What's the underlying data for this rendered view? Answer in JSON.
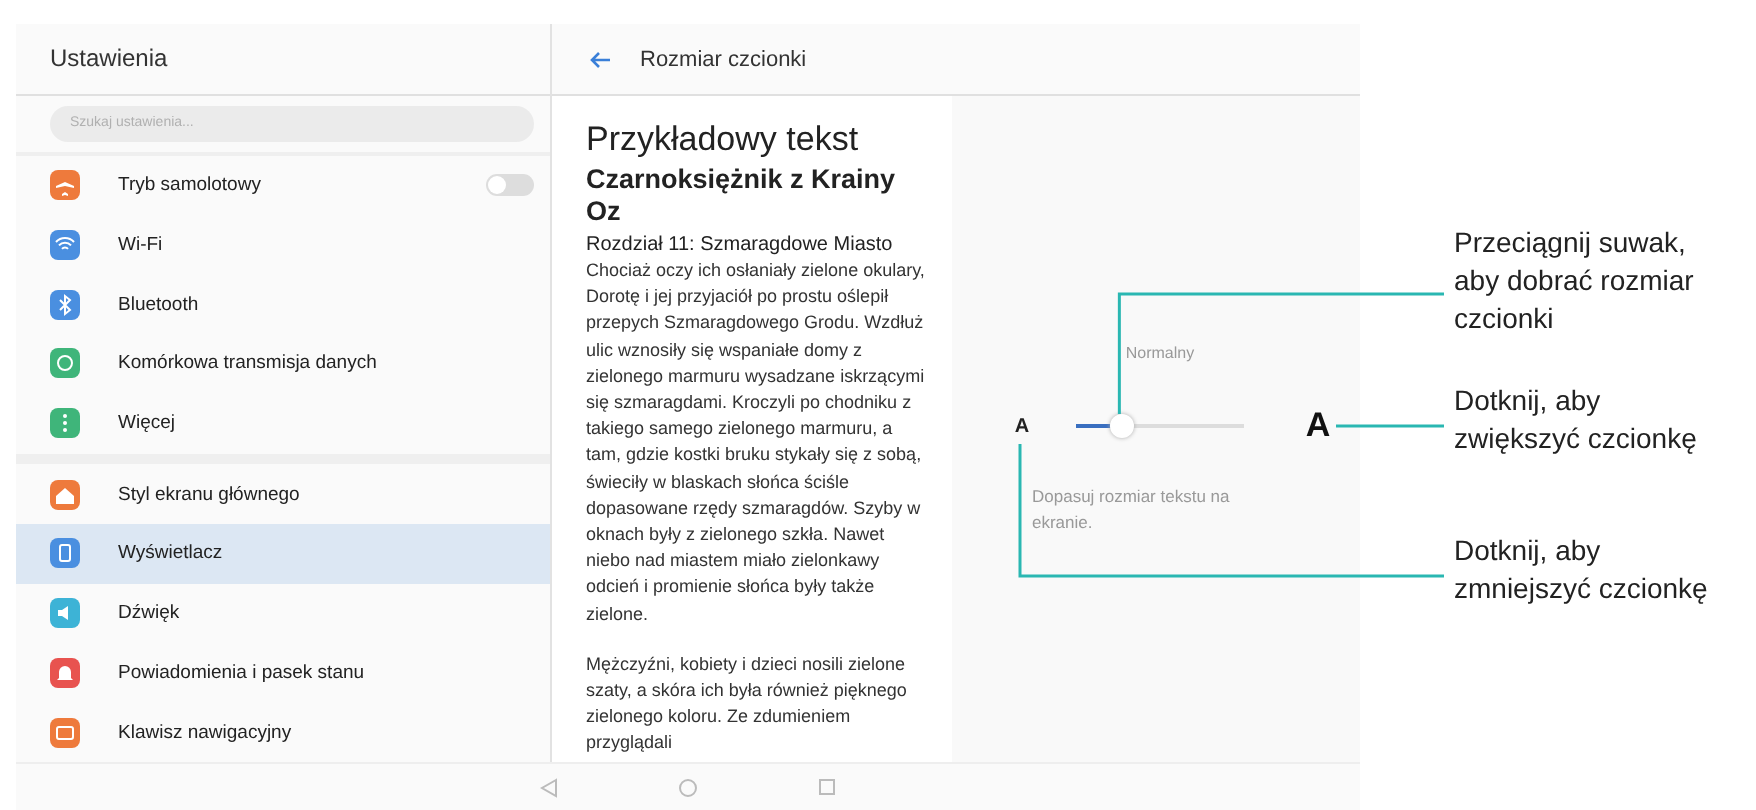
{
  "sidebar": {
    "title": "Ustawienia",
    "search": {
      "placeholder": "Szukaj ustawienia..."
    },
    "groups": [
      [
        {
          "label": "Tryb samolotowy",
          "kind": "airplane",
          "color": "#ee7a3c",
          "selected": false,
          "toggle": {
            "on": false
          }
        },
        {
          "label": "Wi-Fi",
          "kind": "wifi",
          "color": "#4a8fe0",
          "selected": false
        },
        {
          "label": "Bluetooth",
          "kind": "bluetooth",
          "color": "#4a8fe0",
          "selected": false
        },
        {
          "label": "Komórkowa transmisja danych",
          "kind": "data",
          "color": "#3fb57a",
          "selected": false
        },
        {
          "label": "Więcej",
          "kind": "more",
          "color": "#3fb57a",
          "selected": false
        }
      ],
      [
        {
          "label": "Styl ekranu głównego",
          "kind": "home",
          "color": "#ee7a3c",
          "selected": false
        },
        {
          "label": "Wyświetlacz",
          "kind": "display",
          "color": "#4a8fe0",
          "selected": true
        },
        {
          "label": "Dźwięk",
          "kind": "sound",
          "color": "#3db3d6",
          "selected": false
        },
        {
          "label": "Powiadomienia i pasek stanu",
          "kind": "bell",
          "color": "#e8534f",
          "selected": false
        },
        {
          "label": "Klawisz nawigacyjny",
          "kind": "keyboard",
          "color": "#ee7a3c",
          "selected": false
        }
      ]
    ]
  },
  "header": {
    "title": "Rozmiar czcionki"
  },
  "sample": {
    "heading": "Przykładowy tekst",
    "title": "Czarnoksiężnik z Krainy Oz",
    "chapter": "Rozdział 11: Szmaragdowe Miasto",
    "paragraphs": [
      "Chociaż oczy ich osłaniały zielone okulary, Dorotę i jej przyjaciół po prostu oślepił przepych Szmaragdowego Grodu. Wzdłuż ulic wznosiły się wspaniałe domy z zielonego marmuru wysadzane iskrzącymi się szmaragdami. Kroczyli po chodniku z takiego samego zielonego marmuru, a tam, gdzie kostki bruku stykały się z sobą, świeciły w blaskach słońca ściśle dopasowane rzędy szmaragdów. Szyby w oknach były z zielonego szkła. Nawet niebo nad miastem miało zielonkawy odcień i promienie słońca były także zielone.",
      "Mężczyźni, kobiety i dzieci nosili zielone szaty, a skóra ich była również pięknego zielonego koloru. Ze zdumieniem przyglądali"
    ]
  },
  "font_size": {
    "label": "Normalny",
    "small": "A",
    "large": "A",
    "level": 0.27,
    "caption": "Dopasuj rozmiar tekstu na ekranie."
  },
  "callouts": [
    {
      "text": "Przeciągnij suwak, aby dobrać rozmiar czcionki"
    },
    {
      "text": "Dotknij, aby zwiększyć czcionkę"
    },
    {
      "text": "Dotknij, aby zmniejszyć czcionkę"
    }
  ]
}
